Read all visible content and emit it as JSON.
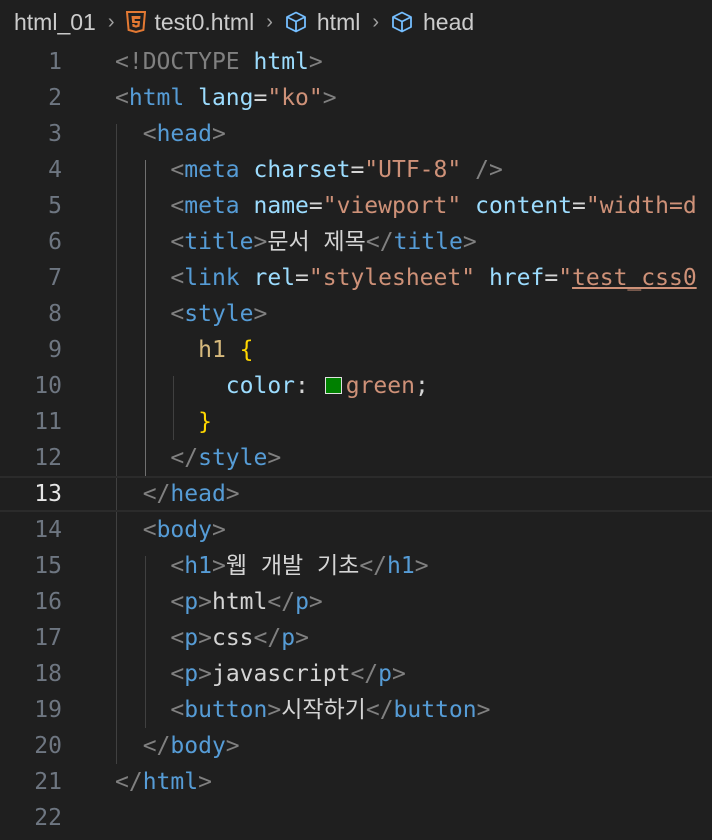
{
  "breadcrumb": {
    "folder": "html_01",
    "file": "test0.html",
    "element1": "html",
    "element2": "head",
    "separator": "›"
  },
  "editor": {
    "current_line": 13,
    "swatch_color": "#008000",
    "lines": [
      {
        "n": "1",
        "parts": [
          {
            "c": "t-bracket",
            "t": "<"
          },
          {
            "c": "t-bracket",
            "t": "!DOCTYPE"
          },
          {
            "c": "t-text",
            "t": " "
          },
          {
            "c": "t-attr",
            "t": "html"
          },
          {
            "c": "t-bracket",
            "t": ">"
          }
        ]
      },
      {
        "n": "2",
        "parts": [
          {
            "c": "t-bracket",
            "t": "<"
          },
          {
            "c": "t-tag",
            "t": "html"
          },
          {
            "c": "t-text",
            "t": " "
          },
          {
            "c": "t-attr",
            "t": "lang"
          },
          {
            "c": "t-text",
            "t": "="
          },
          {
            "c": "t-str",
            "t": "\"ko\""
          },
          {
            "c": "t-bracket",
            "t": ">"
          }
        ]
      },
      {
        "n": "3",
        "parts": [
          {
            "c": "t-text",
            "t": "  "
          },
          {
            "c": "t-bracket",
            "t": "<"
          },
          {
            "c": "t-tag",
            "t": "head"
          },
          {
            "c": "t-bracket",
            "t": ">"
          }
        ]
      },
      {
        "n": "4",
        "parts": [
          {
            "c": "t-text",
            "t": "    "
          },
          {
            "c": "t-bracket",
            "t": "<"
          },
          {
            "c": "t-tag",
            "t": "meta"
          },
          {
            "c": "t-text",
            "t": " "
          },
          {
            "c": "t-attr",
            "t": "charset"
          },
          {
            "c": "t-text",
            "t": "="
          },
          {
            "c": "t-str",
            "t": "\"UTF-8\""
          },
          {
            "c": "t-text",
            "t": " "
          },
          {
            "c": "t-bracket",
            "t": "/>"
          }
        ]
      },
      {
        "n": "5",
        "parts": [
          {
            "c": "t-text",
            "t": "    "
          },
          {
            "c": "t-bracket",
            "t": "<"
          },
          {
            "c": "t-tag",
            "t": "meta"
          },
          {
            "c": "t-text",
            "t": " "
          },
          {
            "c": "t-attr",
            "t": "name"
          },
          {
            "c": "t-text",
            "t": "="
          },
          {
            "c": "t-str",
            "t": "\"viewport\""
          },
          {
            "c": "t-text",
            "t": " "
          },
          {
            "c": "t-attr",
            "t": "content"
          },
          {
            "c": "t-text",
            "t": "="
          },
          {
            "c": "t-str",
            "t": "\"width=d"
          }
        ]
      },
      {
        "n": "6",
        "parts": [
          {
            "c": "t-text",
            "t": "    "
          },
          {
            "c": "t-bracket",
            "t": "<"
          },
          {
            "c": "t-tag",
            "t": "title"
          },
          {
            "c": "t-bracket",
            "t": ">"
          },
          {
            "c": "t-text",
            "t": "문서 제목"
          },
          {
            "c": "t-bracket",
            "t": "</"
          },
          {
            "c": "t-tag",
            "t": "title"
          },
          {
            "c": "t-bracket",
            "t": ">"
          }
        ]
      },
      {
        "n": "7",
        "parts": [
          {
            "c": "t-text",
            "t": "    "
          },
          {
            "c": "t-bracket",
            "t": "<"
          },
          {
            "c": "t-tag",
            "t": "link"
          },
          {
            "c": "t-text",
            "t": " "
          },
          {
            "c": "t-attr",
            "t": "rel"
          },
          {
            "c": "t-text",
            "t": "="
          },
          {
            "c": "t-str",
            "t": "\"stylesheet\""
          },
          {
            "c": "t-text",
            "t": " "
          },
          {
            "c": "t-attr",
            "t": "href"
          },
          {
            "c": "t-text",
            "t": "="
          },
          {
            "c": "t-str",
            "t": "\""
          },
          {
            "c": "t-str-link",
            "t": "test_css0"
          }
        ]
      },
      {
        "n": "8",
        "parts": [
          {
            "c": "t-text",
            "t": "    "
          },
          {
            "c": "t-bracket",
            "t": "<"
          },
          {
            "c": "t-tag",
            "t": "style"
          },
          {
            "c": "t-bracket",
            "t": ">"
          }
        ]
      },
      {
        "n": "9",
        "parts": [
          {
            "c": "t-text",
            "t": "      "
          },
          {
            "c": "t-sel",
            "t": "h1"
          },
          {
            "c": "t-text",
            "t": " "
          },
          {
            "c": "t-brace",
            "t": "{"
          }
        ]
      },
      {
        "n": "10",
        "parts": [
          {
            "c": "t-text",
            "t": "        "
          },
          {
            "c": "t-prop",
            "t": "color"
          },
          {
            "c": "t-text",
            "t": ": "
          },
          {
            "c": "swatch",
            "t": ""
          },
          {
            "c": "t-val",
            "t": "green"
          },
          {
            "c": "t-text",
            "t": ";"
          }
        ]
      },
      {
        "n": "11",
        "parts": [
          {
            "c": "t-text",
            "t": "      "
          },
          {
            "c": "t-brace",
            "t": "}"
          }
        ]
      },
      {
        "n": "12",
        "parts": [
          {
            "c": "t-text",
            "t": "    "
          },
          {
            "c": "t-bracket",
            "t": "</"
          },
          {
            "c": "t-tag",
            "t": "style"
          },
          {
            "c": "t-bracket",
            "t": ">"
          }
        ]
      },
      {
        "n": "13",
        "parts": [
          {
            "c": "t-text",
            "t": "  "
          },
          {
            "c": "t-bracket",
            "t": "</"
          },
          {
            "c": "t-tag",
            "t": "head"
          },
          {
            "c": "t-bracket",
            "t": ">"
          }
        ]
      },
      {
        "n": "14",
        "parts": [
          {
            "c": "t-text",
            "t": "  "
          },
          {
            "c": "t-bracket",
            "t": "<"
          },
          {
            "c": "t-tag",
            "t": "body"
          },
          {
            "c": "t-bracket",
            "t": ">"
          }
        ]
      },
      {
        "n": "15",
        "parts": [
          {
            "c": "t-text",
            "t": "    "
          },
          {
            "c": "t-bracket",
            "t": "<"
          },
          {
            "c": "t-tag",
            "t": "h1"
          },
          {
            "c": "t-bracket",
            "t": ">"
          },
          {
            "c": "t-text",
            "t": "웹 개발 기초"
          },
          {
            "c": "t-bracket",
            "t": "</"
          },
          {
            "c": "t-tag",
            "t": "h1"
          },
          {
            "c": "t-bracket",
            "t": ">"
          }
        ]
      },
      {
        "n": "16",
        "parts": [
          {
            "c": "t-text",
            "t": "    "
          },
          {
            "c": "t-bracket",
            "t": "<"
          },
          {
            "c": "t-tag",
            "t": "p"
          },
          {
            "c": "t-bracket",
            "t": ">"
          },
          {
            "c": "t-text",
            "t": "html"
          },
          {
            "c": "t-bracket",
            "t": "</"
          },
          {
            "c": "t-tag",
            "t": "p"
          },
          {
            "c": "t-bracket",
            "t": ">"
          }
        ]
      },
      {
        "n": "17",
        "parts": [
          {
            "c": "t-text",
            "t": "    "
          },
          {
            "c": "t-bracket",
            "t": "<"
          },
          {
            "c": "t-tag",
            "t": "p"
          },
          {
            "c": "t-bracket",
            "t": ">"
          },
          {
            "c": "t-text",
            "t": "css"
          },
          {
            "c": "t-bracket",
            "t": "</"
          },
          {
            "c": "t-tag",
            "t": "p"
          },
          {
            "c": "t-bracket",
            "t": ">"
          }
        ]
      },
      {
        "n": "18",
        "parts": [
          {
            "c": "t-text",
            "t": "    "
          },
          {
            "c": "t-bracket",
            "t": "<"
          },
          {
            "c": "t-tag",
            "t": "p"
          },
          {
            "c": "t-bracket",
            "t": ">"
          },
          {
            "c": "t-text",
            "t": "javascript"
          },
          {
            "c": "t-bracket",
            "t": "</"
          },
          {
            "c": "t-tag",
            "t": "p"
          },
          {
            "c": "t-bracket",
            "t": ">"
          }
        ]
      },
      {
        "n": "19",
        "parts": [
          {
            "c": "t-text",
            "t": "    "
          },
          {
            "c": "t-bracket",
            "t": "<"
          },
          {
            "c": "t-tag",
            "t": "button"
          },
          {
            "c": "t-bracket",
            "t": ">"
          },
          {
            "c": "t-text",
            "t": "시작하기"
          },
          {
            "c": "t-bracket",
            "t": "</"
          },
          {
            "c": "t-tag",
            "t": "button"
          },
          {
            "c": "t-bracket",
            "t": ">"
          }
        ]
      },
      {
        "n": "20",
        "parts": [
          {
            "c": "t-text",
            "t": "  "
          },
          {
            "c": "t-bracket",
            "t": "</"
          },
          {
            "c": "t-tag",
            "t": "body"
          },
          {
            "c": "t-bracket",
            "t": ">"
          }
        ]
      },
      {
        "n": "21",
        "parts": [
          {
            "c": "t-bracket",
            "t": "</"
          },
          {
            "c": "t-tag",
            "t": "html"
          },
          {
            "c": "t-bracket",
            "t": ">"
          }
        ]
      },
      {
        "n": "22",
        "parts": []
      }
    ]
  }
}
